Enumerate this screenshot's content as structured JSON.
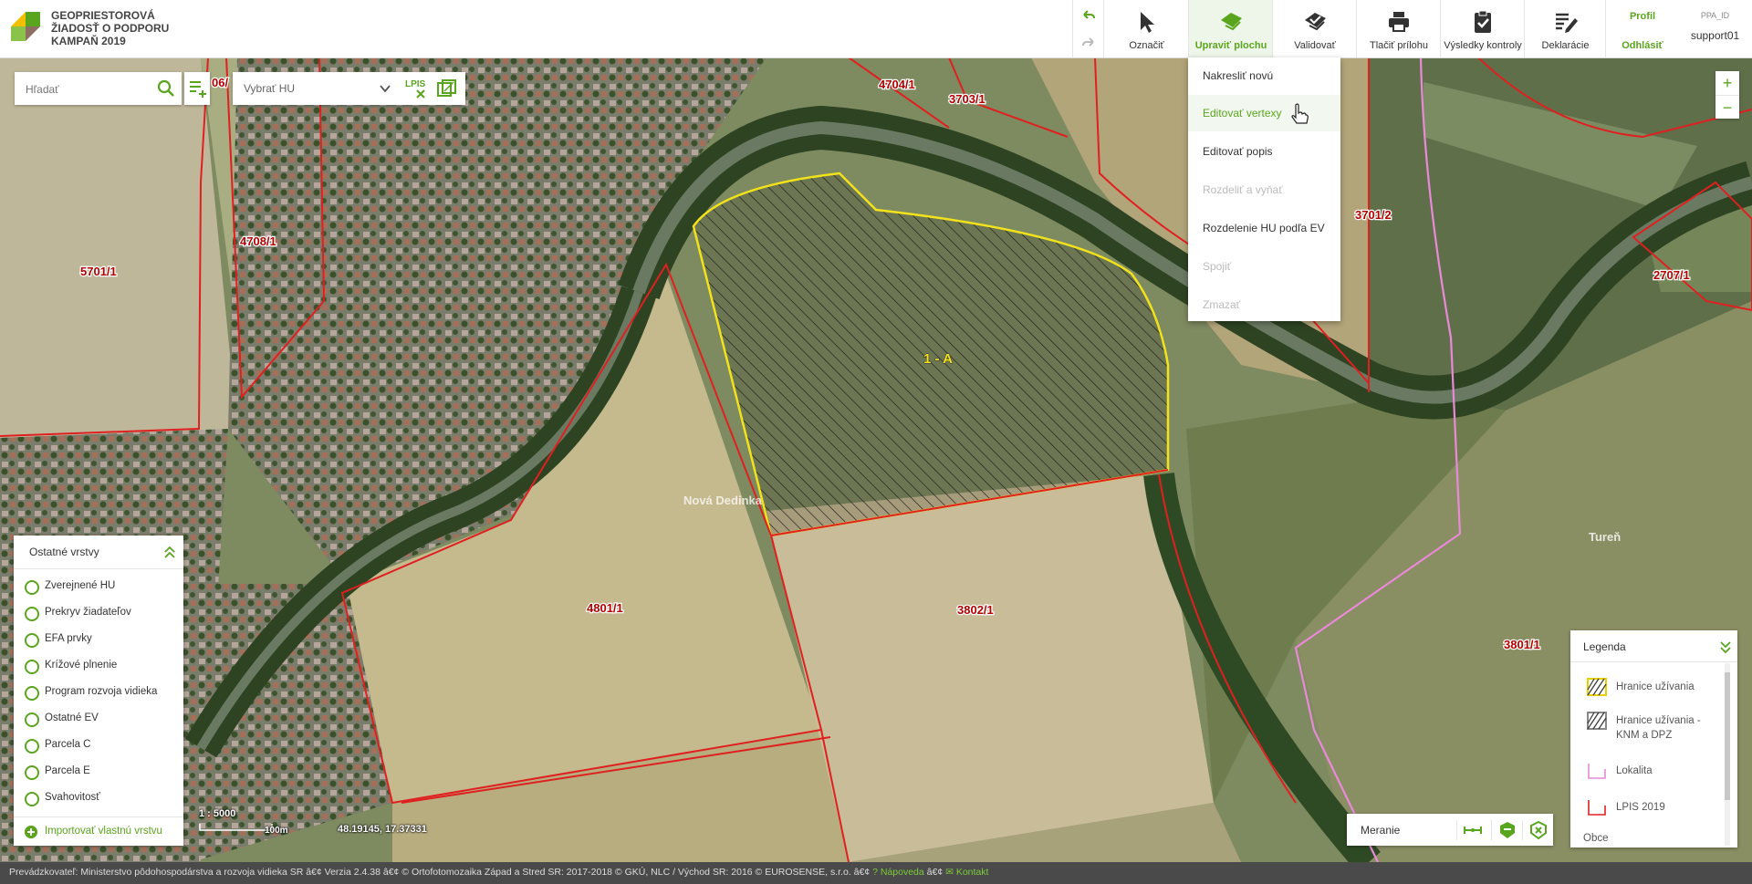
{
  "header": {
    "title_lines": [
      "GEOPRIESTOROVÁ",
      "ŽIADOSŤ O PODPORU",
      "KAMPAŇ 2019"
    ],
    "tools": [
      {
        "label": "Označiť",
        "icon": "cursor-arrow-icon"
      },
      {
        "label": "Upraviť plochu",
        "icon": "edit-area-icon",
        "active": true
      },
      {
        "label": "Validovať",
        "icon": "validate-icon"
      },
      {
        "label": "Tlačiť prílohu",
        "icon": "printer-icon"
      },
      {
        "label": "Výsledky kontroly",
        "icon": "clipboard-check-icon"
      },
      {
        "label": "Deklarácie",
        "icon": "declaration-icon"
      }
    ],
    "profile_label": "Profil",
    "logout_label": "Odhlásiť",
    "ppa_id_label": "PPA_ID",
    "ppa_id_value": "support01"
  },
  "search": {
    "placeholder": "Hľadať"
  },
  "hu_select": {
    "placeholder": "Vybrať HU",
    "lpis_label": "LPIS"
  },
  "edit_menu": [
    {
      "label": "Nakresliť novú",
      "state": "normal"
    },
    {
      "label": "Editovať vertexy",
      "state": "highlighted"
    },
    {
      "label": "Editovať popis",
      "state": "normal"
    },
    {
      "label": "Rozdeliť a vyňať",
      "state": "disabled"
    },
    {
      "label": "Rozdelenie HU podľa EV",
      "state": "normal"
    },
    {
      "label": "Spojiť",
      "state": "disabled"
    },
    {
      "label": "Zmazať",
      "state": "disabled"
    }
  ],
  "zoom": {
    "in": "+",
    "out": "−"
  },
  "layers": {
    "title": "Ostatné vrstvy",
    "items": [
      "Zverejnené HU",
      "Prekryv žiadateľov",
      "EFA prvky",
      "Krížové plnenie",
      "Program rozvoja vidieka",
      "Ostatné EV",
      "Parcela C",
      "Parcela E",
      "Svahovitosť"
    ],
    "import_label": "Importovať vlastnú vrstvu"
  },
  "scale": {
    "ratio": "1 : 5000",
    "bar_label": "100m"
  },
  "coordinates": "48.19145, 17.37331",
  "measure": {
    "label": "Meranie"
  },
  "legend": {
    "title": "Legenda",
    "items": [
      "Hranice užívania",
      "Hranice užívania - KNM a DPZ",
      "Lokalita",
      "LPIS 2019",
      "Obce"
    ]
  },
  "map_labels": {
    "parcels": [
      "4704/1",
      "3703/1",
      "3701/2",
      "2707/1",
      "4708/1",
      "5701/1",
      "4801/1",
      "3802/1",
      "3801/1",
      "06/"
    ],
    "selected_hu": "1 - A",
    "towns": [
      "Nová Dedinka",
      "Tureň"
    ]
  },
  "colors": {
    "accent": "#5aa51e",
    "parcel_border": "#e02020",
    "hu_border": "#f2e21c",
    "locality": "#e88ad8"
  },
  "footer": {
    "text": "Prevádzkovateľ: Ministerstvo pôdohospodárstva a rozvoja vidieka SR â€¢ Verzia 2.4.38 â€¢ © Ortofotomozaika Západ a Stred SR: 2017-2018 © GKÚ, NLC / Východ SR: 2016 © EUROSENSE, s.r.o. â€¢",
    "help": "? Nápoveda",
    "sep": "â€¢",
    "contact": "Kontakt"
  }
}
